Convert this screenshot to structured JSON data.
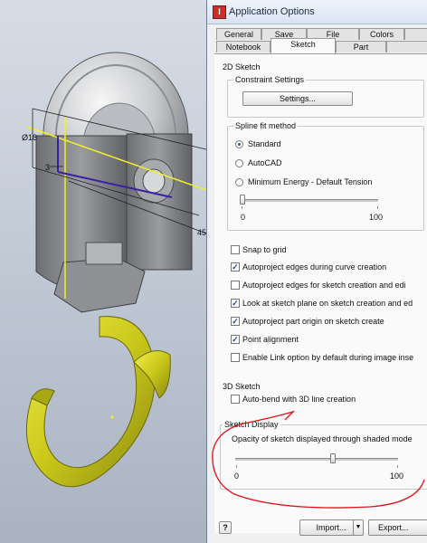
{
  "viewport": {
    "dimensions": {
      "diameter": "Ø18",
      "offset": "3",
      "length": "45"
    }
  },
  "dialog": {
    "title": "Application Options",
    "tabs_row1": [
      "General",
      "Save",
      "File",
      "Colors"
    ],
    "tabs_row2": [
      "Notebook",
      "Sketch",
      "Part"
    ],
    "active_tab": "Sketch",
    "sketch2d": {
      "section_title": "2D Sketch",
      "constraint_group_title": "Constraint Settings",
      "settings_button": "Settings...",
      "spline_group_title": "Spline fit method",
      "spline_options": [
        {
          "label": "Standard",
          "selected": true
        },
        {
          "label": "AutoCAD",
          "selected": false
        },
        {
          "label": "Minimum Energy - Default Tension",
          "selected": false
        }
      ],
      "tension_slider": {
        "min_label": "0",
        "max_label": "100",
        "value": 0
      },
      "checkboxes": [
        {
          "label": "Snap to grid",
          "checked": false
        },
        {
          "label": "Autoproject edges during curve creation",
          "checked": true
        },
        {
          "label": "Autoproject edges for sketch creation and edi",
          "checked": false
        },
        {
          "label": "Look at sketch plane on sketch creation and ed",
          "checked": true
        },
        {
          "label": "Autoproject part origin on sketch create",
          "checked": true
        },
        {
          "label": "Point alignment",
          "checked": true
        },
        {
          "label": "Enable Link option by default during image inse",
          "checked": false
        }
      ]
    },
    "sketch3d": {
      "section_title": "3D Sketch",
      "auto_bend_label": "Auto-bend with 3D line creation",
      "auto_bend_checked": false
    },
    "sketch_display": {
      "section_title": "Sketch Display",
      "opacity_label": "Opacity of sketch displayed through shaded mode",
      "slider": {
        "min_label": "0",
        "max_label": "100",
        "value": 60
      }
    },
    "footer": {
      "help_icon_label": "?",
      "import_button": "Import...",
      "export_button": "Export..."
    }
  },
  "colors": {
    "annotation_red": "#e0131a",
    "hook_yellow": "#d6d41d",
    "sketch_purple": "#3a1fa6",
    "sketch_yellow": "#f2ee2a"
  }
}
